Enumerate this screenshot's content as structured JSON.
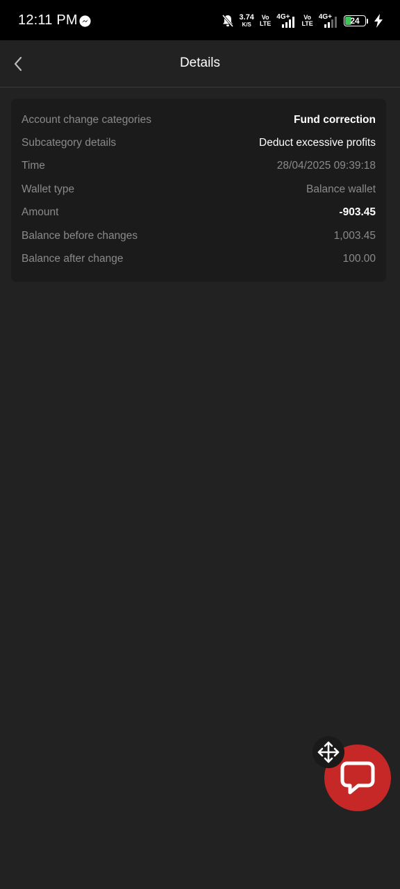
{
  "status_bar": {
    "time": "12:11 PM",
    "net_speed_value": "3.74",
    "net_speed_unit": "K/S",
    "volte1_top": "Vo",
    "volte1_bottom": "LTE",
    "sig1_label": "4G+",
    "volte2_top": "Vo",
    "volte2_bottom": "LTE",
    "sig2_label": "4G+",
    "battery_level": "24",
    "battery_color": "#3ec45a"
  },
  "header": {
    "title": "Details"
  },
  "details": {
    "rows": [
      {
        "label": "Account change categories",
        "value": "Fund correction"
      },
      {
        "label": "Subcategory details",
        "value": "Deduct excessive profits"
      },
      {
        "label": "Time",
        "value": "28/04/2025 09:39:18"
      },
      {
        "label": "Wallet type",
        "value": "Balance wallet"
      },
      {
        "label": "Amount",
        "value": "-903.45"
      },
      {
        "label": "Balance before changes",
        "value": "1,003.45"
      },
      {
        "label": "Balance after change",
        "value": "100.00"
      }
    ]
  },
  "colors": {
    "background": "#222222",
    "card": "#1b1b1b",
    "chat_button": "#c62828"
  },
  "icons": {
    "back": "chevron-left-icon",
    "move": "move-arrows-icon",
    "chat": "chat-bubble-icon",
    "messenger": "messenger-icon",
    "bell_off": "bell-off-icon"
  }
}
